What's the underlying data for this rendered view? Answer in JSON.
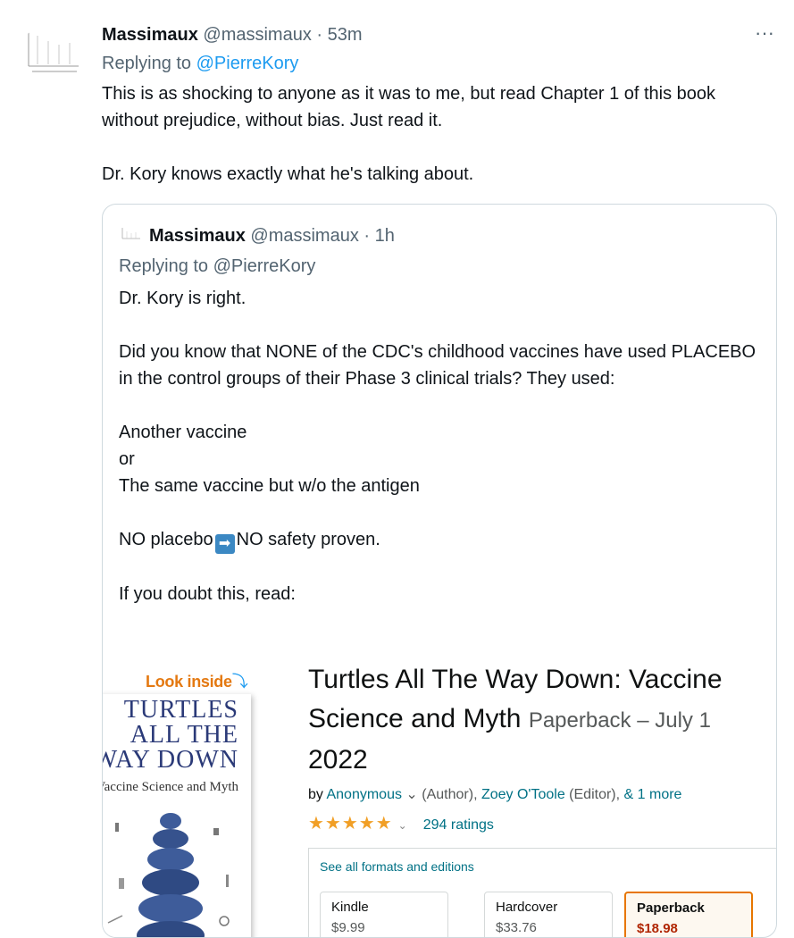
{
  "tweet": {
    "author_name": "Massimaux",
    "author_handle": "@massimaux",
    "separator": "·",
    "time": "53m",
    "more_label": "···",
    "replying_prefix": "Replying to ",
    "replying_to": "@PierreKory",
    "paragraphs": [
      "This is as shocking to anyone as it was to me, but read Chapter 1 of this book without prejudice, without bias. Just read it.",
      "Dr. Kory knows exactly what he's talking about."
    ]
  },
  "quote": {
    "author_name": "Massimaux",
    "author_handle": "@massimaux",
    "separator": "·",
    "time": "1h",
    "replying_text": "Replying to @PierreKory",
    "line_1": "Dr. Kory is right.",
    "line_2": "Did you know that NONE of the CDC's childhood vaccines have used PLACEBO in the control groups of their Phase 3 clinical trials? They used:",
    "line_3": "Another vaccine",
    "line_4": "or",
    "line_5": "The same vaccine but w/o the antigen",
    "line_6a": "NO placebo",
    "line_6_emoji": "➡",
    "line_6b": "NO safety proven.",
    "line_7": "If you doubt this, read:"
  },
  "amazon": {
    "look_inside": "Look inside",
    "look_inside_arrow": "⤵",
    "cover_line_1": "TURTLES",
    "cover_line_2": "ALL THE",
    "cover_line_3": "WAY DOWN",
    "cover_subtitle": "Vaccine Science and Myth",
    "title": "Turtles All The Way Down: Vaccine Science and Myth",
    "edition": "Paperback – July 1",
    "year": "2022",
    "by_prefix": "by ",
    "author": "Anonymous",
    "author_chevron": "⌄",
    "author_role": "(Author), ",
    "editor": "Zoey O'Toole",
    "editor_role": " (Editor), ",
    "more": "& 1 more",
    "stars": "★★★★★",
    "rating_chevron": "⌄",
    "ratings": "294 ratings",
    "formats_link": "See all formats and editions",
    "formats": [
      {
        "name": "Kindle",
        "price": "$9.99"
      },
      {
        "name": "Hardcover",
        "price": "$33.76"
      },
      {
        "name": "Paperback",
        "price": "$18.98"
      }
    ]
  },
  "colors": {
    "link_blue": "#1d9bf0",
    "secondary_text": "#536471",
    "amazon_orange": "#e47911",
    "amazon_link": "#007185",
    "price_red": "#b12704"
  }
}
